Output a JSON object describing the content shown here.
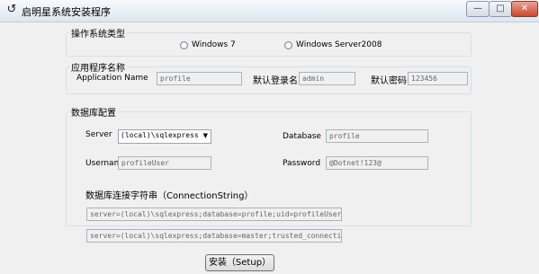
{
  "window": {
    "title": "启明星系统安装程序",
    "icon": "app-icon",
    "controls": {
      "minimize": "—",
      "maximize": "□",
      "close": "✕"
    }
  },
  "os_group": {
    "legend": "操作系统类型",
    "options": [
      "Windows 7",
      "Windows Server2008"
    ]
  },
  "app_group": {
    "legend": "应用程序名称",
    "app_name_label": "Application Name",
    "app_name_value": "profile",
    "login_label": "默认登录名",
    "login_value": "admin",
    "password_label": "默认密码",
    "password_value": "123456"
  },
  "db_group": {
    "legend": "数据库配置",
    "server_label": "Server",
    "server_value": "(local)\\sqlexpress",
    "database_label": "Database",
    "database_value": "profile",
    "username_label": "Username",
    "username_value": "profileUser",
    "password_label": "Password",
    "password_value": "@Dotnet!123@",
    "connstr_label": "数据库连接字符串（ConnectionString）",
    "connstr_value": "server=(local)\\sqlexpress;database=profile;uid=profileUser;pwd=",
    "connstr_master_value": "server=(local)\\sqlexpress;database=master;trusted_connection=y"
  },
  "install_button": "安装（Setup）"
}
